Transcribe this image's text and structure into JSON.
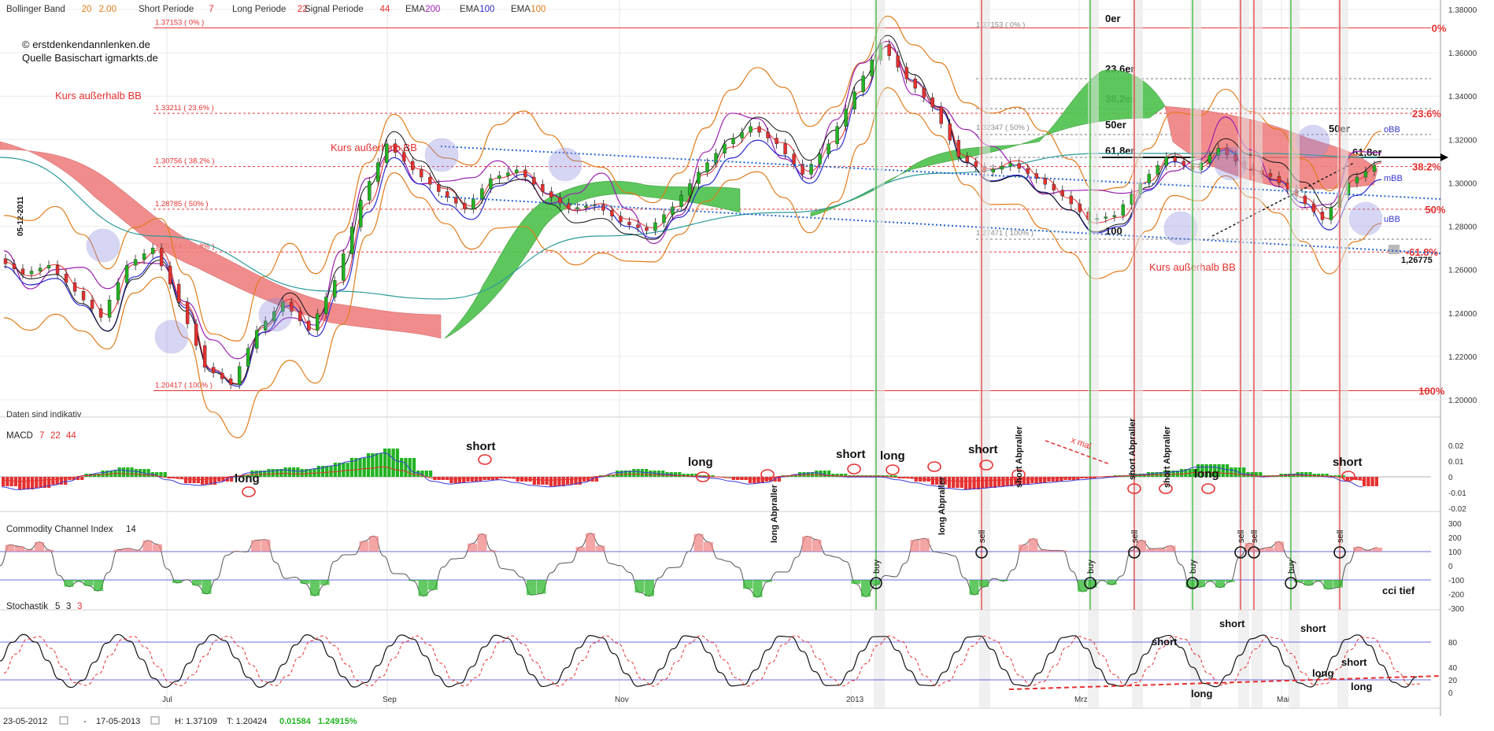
{
  "header": {
    "items": [
      {
        "label": "Bollinger Band",
        "v1": "20",
        "v2": "2.00"
      },
      {
        "label": "Short Periode",
        "v1": "7"
      },
      {
        "label": "Long Periode",
        "v1": "22"
      },
      {
        "label": "Signal Periode",
        "v1": "44"
      },
      {
        "label": "EMA",
        "v1": "200"
      },
      {
        "label": "EMA",
        "v1": "100"
      },
      {
        "label": "EMA",
        "v1": "100"
      }
    ],
    "copyright": "© erstdenkendannlenken.de",
    "source": "Quelle Basischart igmarkts.de",
    "disclaimer": "Daten sind indikativ"
  },
  "colors": {
    "red": "#e53030",
    "green": "#21b321",
    "fibo": "#e53030",
    "kumo_red": "#f08080",
    "kumo_green": "#4cc24c",
    "boll": "#e07b1a",
    "ema200": "#9b1fb0",
    "ema100_blue": "#2a2ad0",
    "teal": "#2a9a9a",
    "axis": "#444444"
  },
  "footer": {
    "from": "23-05-2012",
    "to": "17-05-2013",
    "high": "H: 1.37109",
    "low": "T: 1.20424",
    "change": "0.01584",
    "pct": "1.24915%"
  },
  "chart_data": [
    {
      "type": "line",
      "panel": "price",
      "ylim": [
        1.2,
        1.38
      ],
      "y_ticks": [
        "1.38000",
        "1.36000",
        "1.34000",
        "1.32000",
        "1.30000",
        "1.28000",
        "1.26000",
        "1.24000",
        "1.22000",
        "1.20000"
      ],
      "x_ticks": [
        "Jul",
        "Sep",
        "Nov",
        "2013",
        "Mrz",
        "Mai"
      ],
      "vertical_date_label": "05-12-2011",
      "fibonacci": [
        {
          "level": "1.37153 ( 0% )",
          "value": 1.37153,
          "right_label": "0%"
        },
        {
          "level": "1.33211 ( 23.6% )",
          "value": 1.33211,
          "right_label": "23.6%"
        },
        {
          "level": "1.30756 ( 38.2% )",
          "value": 1.30756,
          "right_label": "38.2%"
        },
        {
          "level": "1.28785 ( 50% )",
          "value": 1.28785,
          "right_label": "50%"
        },
        {
          "level": "1.26814 ( 61.8% )",
          "value": 1.26814,
          "right_label": "-61.8%"
        },
        {
          "level": "1.20417 ( 100% )",
          "value": 1.20417,
          "right_label": "100%"
        }
      ],
      "fib2_labels": [
        "1.37153 ( 0% )",
        "1.32347 ( 50% )",
        "1.27471 ( 100% )"
      ],
      "fib2_marks": [
        "0er",
        "23,6er",
        "38,2er",
        "50er",
        "61,8er",
        "100"
      ],
      "right_marks": [
        "50er",
        "61,8er",
        "oBB",
        "mBB",
        "uBB",
        "1,26775"
      ],
      "annotations": [
        "Kurs außerhalb BB",
        "Kurs außerhalb BB",
        "Kurs außerhalb BB"
      ],
      "close_points": [
        1.265,
        1.258,
        1.262,
        1.25,
        1.238,
        1.262,
        1.27,
        1.245,
        1.215,
        1.207,
        1.232,
        1.245,
        1.232,
        1.255,
        1.292,
        1.318,
        1.306,
        1.296,
        1.288,
        1.302,
        1.306,
        1.296,
        1.288,
        1.29,
        1.282,
        1.278,
        1.289,
        1.305,
        1.318,
        1.326,
        1.318,
        1.304,
        1.318,
        1.342,
        1.364,
        1.348,
        1.335,
        1.312,
        1.305,
        1.309,
        1.302,
        1.294,
        1.283,
        1.285,
        1.3,
        1.312,
        1.306,
        1.316,
        1.307,
        1.303,
        1.294,
        1.283,
        1.3,
        1.308
      ]
    },
    {
      "type": "bar",
      "panel": "MACD",
      "title": "MACD",
      "params": [
        "7",
        "22",
        "44"
      ],
      "ylim": [
        -0.02,
        0.025
      ],
      "y_ticks": [
        "0.02",
        "0.01",
        "0",
        "-0.01",
        "-0.02"
      ],
      "histogram": [
        -0.006,
        -0.008,
        -0.007,
        -0.005,
        -0.002,
        0.002,
        0.004,
        0.006,
        0.005,
        0.003,
        -0.001,
        -0.004,
        -0.005,
        -0.003,
        0.001,
        0.004,
        0.005,
        0.006,
        0.005,
        0.007,
        0.009,
        0.012,
        0.015,
        0.018,
        0.012,
        0.004,
        -0.002,
        -0.004,
        -0.003,
        -0.002,
        -0.001,
        -0.003,
        -0.005,
        -0.006,
        -0.005,
        -0.003,
        0.001,
        0.004,
        0.005,
        0.004,
        0.003,
        0.002,
        0.001,
        0.0,
        -0.002,
        -0.004,
        -0.003,
        0.001,
        0.003,
        0.004,
        0.002,
        0.001,
        0.001,
        0.001,
        -0.001,
        -0.003,
        -0.005,
        -0.007,
        -0.008,
        -0.007,
        -0.006,
        -0.005,
        -0.004,
        -0.003,
        -0.002,
        -0.001,
        0.0,
        0.001,
        0.002,
        0.003,
        0.004,
        0.005,
        0.008,
        0.008,
        0.006,
        0.003,
        0.001,
        0.002,
        0.003,
        0.002,
        0.001,
        -0.002,
        -0.006
      ],
      "labels": [
        "long",
        "short",
        "long",
        "short",
        "long",
        "short",
        "long",
        "short",
        "long Abpraller",
        "long Abpraller",
        "short Abpraller",
        "short Abpraller",
        "short Abpraller",
        "x mal"
      ]
    },
    {
      "type": "line",
      "panel": "CCI",
      "title": "Commodity Channel Index",
      "params": [
        "14"
      ],
      "ylim": [
        -300,
        300
      ],
      "y_ticks": [
        "300",
        "200",
        "100",
        "0",
        "-100",
        "-200",
        "-300"
      ],
      "signals": [
        "buy",
        "sell",
        "buy",
        "sell",
        "buy",
        "sell",
        "sell",
        "buy",
        "sell"
      ],
      "note": "cci tief"
    },
    {
      "type": "line",
      "panel": "Stochastik",
      "title": "Stochastik",
      "params": [
        "5",
        "3",
        "3"
      ],
      "ylim": [
        0,
        100
      ],
      "y_ticks": [
        "80",
        "40",
        "20",
        "0"
      ],
      "labels": [
        "short",
        "short",
        "short",
        "short",
        "long",
        "long",
        "long"
      ]
    }
  ]
}
